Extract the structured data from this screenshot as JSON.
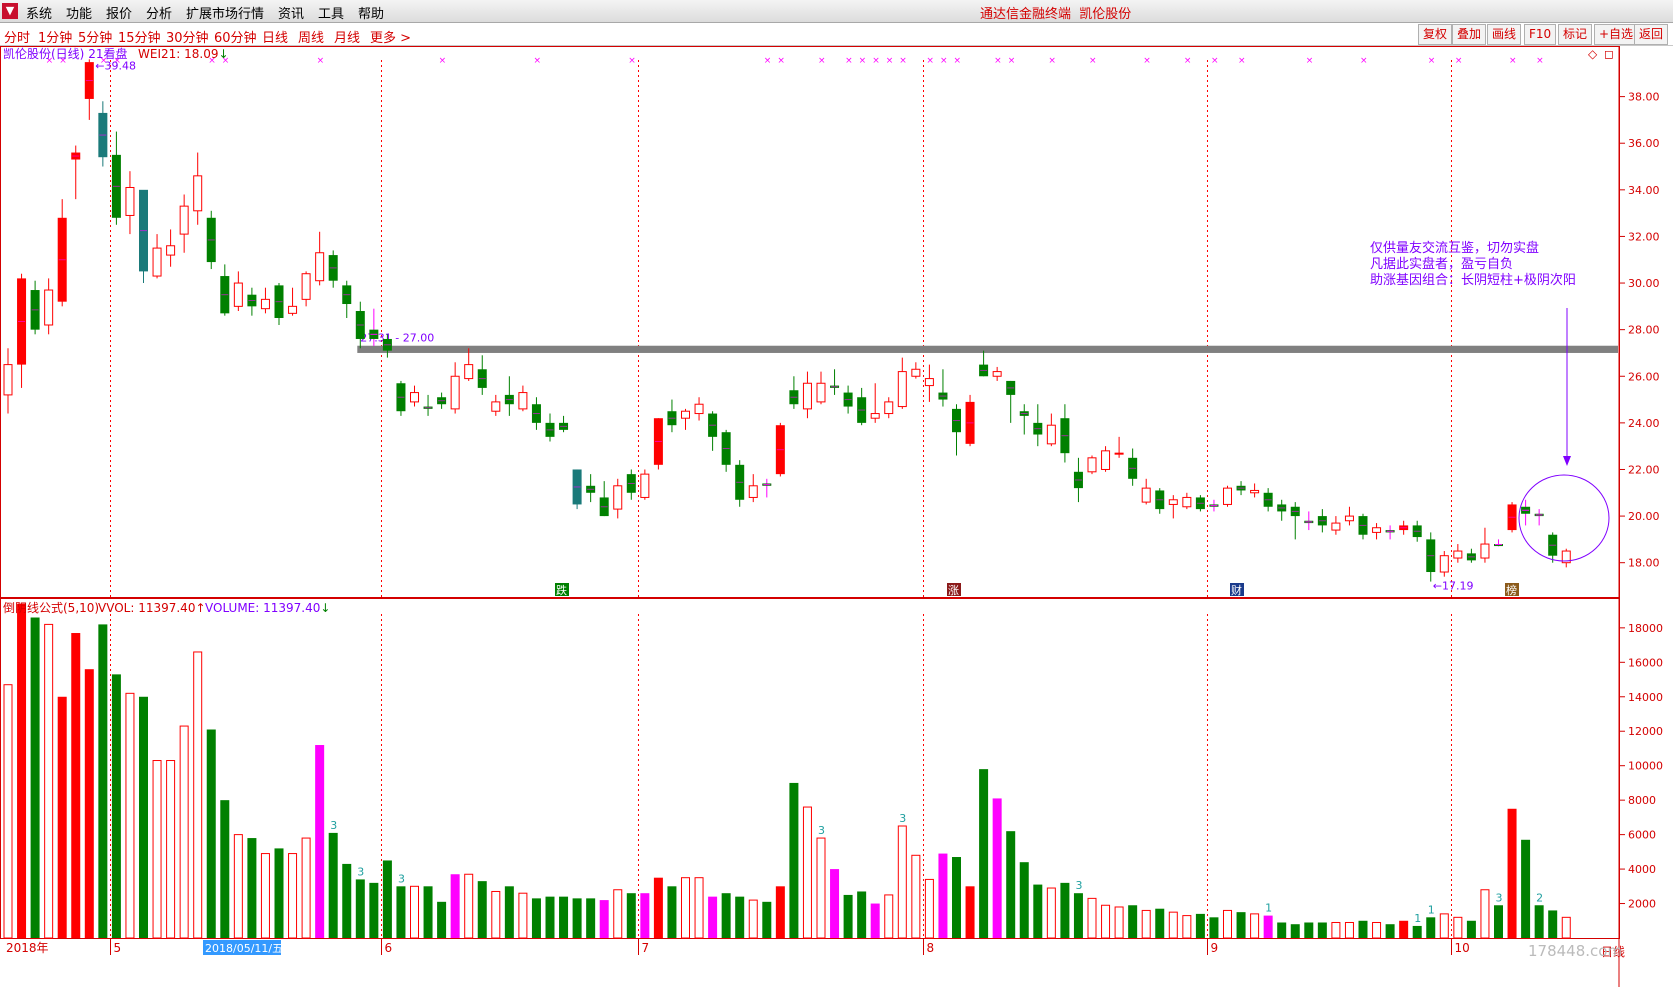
{
  "menu": {
    "items": [
      "系统",
      "功能",
      "报价",
      "分析",
      "扩展市场行情",
      "资讯",
      "工具",
      "帮助"
    ],
    "title": "通达信金融终端",
    "stock": "凯伦股份"
  },
  "periods": {
    "items": [
      "分时",
      "1分钟",
      "5分钟",
      "15分钟",
      "30分钟",
      "60分钟",
      "日线",
      "周线",
      "月线",
      "更多 >"
    ],
    "active": "日线"
  },
  "toolbar": [
    "复权",
    "叠加",
    "画线",
    "F10",
    "标记",
    "+自选",
    "返回"
  ],
  "price_panel": {
    "title_main": "凯伦股份(日线)",
    "title_extra": "21看盘",
    "indicator": "WEI21: 18.09",
    "indicator_arrow": "↓",
    "high_label": "39.48",
    "low_label": "17.19",
    "hline_label": "27.31 - 27.00",
    "y_ticks": [
      "38.00",
      "36.00",
      "34.00",
      "32.00",
      "30.00",
      "28.00",
      "26.00",
      "24.00",
      "22.00",
      "20.00",
      "18.00"
    ],
    "annotation": [
      "仅供量友交流互鉴，切勿实盘",
      "凡据此实盘者，盈亏自负",
      "助涨基因组合：长阴短柱+极阴次阳"
    ],
    "markers": [
      "跌",
      "涨",
      "财",
      "榜"
    ],
    "corner_mark": "◇"
  },
  "volume_panel": {
    "title_formula": "倒阴线公式(5,10)",
    "vvol_label": "VVOL: 11397.40",
    "vvol_arrow": "↑",
    "volume_label": "VOLUME: 11397.40",
    "volume_arrow": "↓",
    "y_ticks": [
      "18000",
      "16000",
      "14000",
      "12000",
      "10000",
      "8000",
      "6000",
      "4000",
      "2000"
    ],
    "counts": [
      "3",
      "3",
      "3",
      "3",
      "3",
      "3",
      "1",
      "1",
      "1",
      "3",
      "2"
    ]
  },
  "date_axis": {
    "year": "2018年",
    "months": [
      "5",
      "6",
      "7",
      "8",
      "9",
      "10"
    ],
    "selected_date": "2018/05/11/五",
    "right_label": "日线",
    "watermark": "178448.com"
  },
  "colors": {
    "up": "#ff0000",
    "down": "#008000",
    "teal": "#1a7a7a",
    "magenta": "#ff00ff",
    "purple": "#8000ff",
    "hline": "#808080",
    "grid_v": "#ff0000",
    "label_red": "#d40000"
  },
  "chart_data": {
    "type": "candlestick",
    "price_range": [
      17,
      40
    ],
    "volume_range": [
      0,
      19500
    ],
    "candles": [
      [
        25.2,
        26.5,
        27.2,
        24.4,
        "h",
        14700
      ],
      [
        26.5,
        30.2,
        30.4,
        25.5,
        "f",
        19400
      ],
      [
        29.7,
        28.0,
        30.1,
        27.8,
        "d",
        18600
      ],
      [
        28.2,
        29.7,
        30.2,
        27.8,
        "h",
        18200
      ],
      [
        29.2,
        32.8,
        33.6,
        29.0,
        "f",
        14000
      ],
      [
        35.3,
        35.6,
        35.9,
        33.6,
        "f",
        17700
      ],
      [
        37.9,
        39.48,
        39.6,
        37.0,
        "f",
        15600
      ],
      [
        37.3,
        35.4,
        37.8,
        35.0,
        "t",
        18200
      ],
      [
        35.5,
        32.8,
        36.5,
        32.5,
        "d",
        15300
      ],
      [
        32.9,
        34.1,
        34.8,
        32.1,
        "h",
        14200
      ],
      [
        34.0,
        30.5,
        33.8,
        30.0,
        "t",
        14000
      ],
      [
        30.3,
        31.5,
        32.1,
        30.2,
        "h",
        10300
      ],
      [
        31.2,
        31.6,
        32.3,
        30.7,
        "h",
        10300
      ],
      [
        32.1,
        33.3,
        33.8,
        31.3,
        "h",
        12300
      ],
      [
        33.1,
        34.6,
        35.6,
        32.5,
        "h",
        16600
      ],
      [
        32.8,
        30.9,
        33.1,
        30.6,
        "d",
        12100
      ],
      [
        30.3,
        28.7,
        30.8,
        28.6,
        "d",
        8000
      ],
      [
        29.0,
        30.0,
        30.5,
        28.8,
        "h",
        6000
      ],
      [
        29.5,
        29.0,
        29.8,
        28.6,
        "d",
        5800
      ],
      [
        28.9,
        29.3,
        29.8,
        28.7,
        "h",
        4900
      ],
      [
        29.9,
        28.5,
        30.0,
        28.2,
        "d",
        5200
      ],
      [
        28.7,
        29.0,
        29.8,
        28.6,
        "h",
        4900
      ],
      [
        29.3,
        30.4,
        30.5,
        29.0,
        "h",
        5800
      ],
      [
        30.1,
        31.3,
        32.2,
        29.9,
        "h",
        11200
      ],
      [
        31.2,
        30.1,
        31.4,
        29.8,
        "d",
        6100
      ],
      [
        29.9,
        29.1,
        30.1,
        28.5,
        "d",
        4300
      ],
      [
        28.8,
        27.6,
        29.2,
        27.2,
        "d",
        3400
      ],
      [
        27.6,
        28.0,
        28.9,
        27.3,
        "m",
        3200
      ],
      [
        27.6,
        27.1,
        27.8,
        26.8,
        "d",
        4500
      ],
      [
        25.7,
        24.5,
        25.8,
        24.3,
        "d",
        3000
      ],
      [
        24.9,
        25.3,
        25.6,
        24.7,
        "h",
        3000
      ],
      [
        24.7,
        24.6,
        25.2,
        24.3,
        "d",
        3000
      ],
      [
        25.1,
        24.8,
        25.3,
        24.6,
        "d",
        2100
      ],
      [
        24.6,
        26.0,
        26.6,
        24.4,
        "h",
        3700
      ],
      [
        25.9,
        26.5,
        27.2,
        25.8,
        "h",
        3700
      ],
      [
        26.3,
        25.5,
        26.9,
        25.2,
        "d",
        3300
      ],
      [
        24.9,
        24.5,
        25.2,
        24.3,
        "h",
        2700
      ],
      [
        25.2,
        24.8,
        26.0,
        24.3,
        "d",
        3000
      ],
      [
        24.6,
        25.3,
        25.6,
        24.5,
        "h",
        2600
      ],
      [
        24.8,
        24.0,
        25.1,
        23.7,
        "d",
        2300
      ],
      [
        24.0,
        23.4,
        24.4,
        23.2,
        "d",
        2400
      ],
      [
        24.0,
        23.7,
        24.3,
        23.6,
        "d",
        2400
      ],
      [
        22.0,
        20.5,
        22.0,
        20.3,
        "t",
        2300
      ],
      [
        21.3,
        21.0,
        21.8,
        20.6,
        "d",
        2300
      ],
      [
        20.8,
        20.0,
        21.5,
        20.0,
        "d",
        2200
      ],
      [
        20.3,
        21.3,
        21.6,
        19.9,
        "h",
        2800
      ],
      [
        21.8,
        21.0,
        22.0,
        20.7,
        "d",
        2600
      ],
      [
        20.8,
        21.8,
        22.0,
        20.7,
        "h",
        2600
      ],
      [
        22.2,
        24.2,
        24.2,
        22.0,
        "f",
        3500
      ],
      [
        24.5,
        23.9,
        25.0,
        23.6,
        "d",
        3000
      ],
      [
        24.2,
        24.5,
        24.6,
        23.7,
        "h",
        3500
      ],
      [
        24.8,
        24.4,
        25.1,
        24.1,
        "h",
        3500
      ],
      [
        24.4,
        23.4,
        24.5,
        22.8,
        "d",
        2400
      ],
      [
        23.6,
        22.2,
        23.7,
        21.9,
        "d",
        2600
      ],
      [
        22.2,
        20.7,
        22.4,
        20.4,
        "d",
        2400
      ],
      [
        20.8,
        21.3,
        21.8,
        20.6,
        "h",
        2200
      ],
      [
        21.4,
        21.3,
        21.6,
        20.8,
        "m",
        2100
      ],
      [
        21.8,
        23.9,
        24.0,
        21.7,
        "f",
        3000
      ],
      [
        25.4,
        24.8,
        26.0,
        24.6,
        "d",
        9000
      ],
      [
        24.6,
        25.7,
        26.2,
        24.2,
        "h",
        7600
      ],
      [
        24.9,
        25.7,
        26.2,
        24.8,
        "h",
        5800
      ],
      [
        25.6,
        25.5,
        26.3,
        25.2,
        "d",
        4000
      ],
      [
        25.3,
        24.7,
        25.6,
        24.4,
        "d",
        2500
      ],
      [
        25.1,
        24.0,
        25.5,
        23.9,
        "d",
        2700
      ],
      [
        24.2,
        24.4,
        25.7,
        24.0,
        "h",
        2000
      ],
      [
        24.4,
        24.9,
        25.1,
        24.2,
        "h",
        2500
      ],
      [
        24.7,
        26.2,
        26.8,
        24.6,
        "h",
        6500
      ],
      [
        26.0,
        26.3,
        26.6,
        25.9,
        "h",
        4800
      ],
      [
        25.9,
        25.6,
        26.5,
        24.9,
        "h",
        3400
      ],
      [
        25.3,
        25.0,
        26.3,
        24.7,
        "d",
        4900
      ],
      [
        24.6,
        23.6,
        24.8,
        22.6,
        "d",
        4700
      ],
      [
        23.1,
        24.9,
        25.2,
        23.0,
        "f",
        3000
      ],
      [
        26.0,
        26.5,
        27.1,
        26.0,
        "d",
        9800
      ],
      [
        26.2,
        26.0,
        26.4,
        25.8,
        "h",
        8100
      ],
      [
        25.8,
        25.2,
        25.8,
        24.0,
        "d",
        6200
      ],
      [
        24.5,
        24.3,
        24.8,
        23.5,
        "d",
        4400
      ],
      [
        24.0,
        23.5,
        24.8,
        23.0,
        "d",
        3100
      ],
      [
        23.1,
        23.9,
        24.4,
        23.0,
        "h",
        2900
      ],
      [
        24.2,
        22.7,
        24.8,
        22.3,
        "d",
        3200
      ],
      [
        21.9,
        21.2,
        22.5,
        20.6,
        "d",
        2600
      ],
      [
        21.9,
        22.5,
        22.6,
        21.8,
        "h",
        2300
      ],
      [
        22.0,
        22.8,
        23.0,
        21.9,
        "h",
        1900
      ],
      [
        22.7,
        22.7,
        23.4,
        22.5,
        "h",
        1800
      ],
      [
        22.5,
        21.6,
        22.9,
        21.3,
        "d",
        1900
      ],
      [
        21.2,
        20.6,
        21.6,
        20.5,
        "h",
        1600
      ],
      [
        21.1,
        20.3,
        21.2,
        20.1,
        "d",
        1700
      ],
      [
        20.5,
        20.7,
        20.9,
        19.9,
        "h",
        1500
      ],
      [
        20.4,
        20.8,
        21.0,
        20.3,
        "h",
        1300
      ],
      [
        20.8,
        20.3,
        20.9,
        20.2,
        "d",
        1400
      ],
      [
        20.4,
        20.5,
        20.7,
        20.2,
        "m",
        1200
      ],
      [
        20.5,
        21.2,
        21.3,
        20.4,
        "h",
        1600
      ],
      [
        21.3,
        21.1,
        21.5,
        20.9,
        "d",
        1500
      ],
      [
        21.0,
        21.1,
        21.4,
        20.8,
        "h",
        1400
      ],
      [
        21.0,
        20.4,
        21.2,
        20.2,
        "d",
        1300
      ],
      [
        20.5,
        20.2,
        20.7,
        19.8,
        "d",
        900
      ],
      [
        20.4,
        20.0,
        20.6,
        19.0,
        "d",
        800
      ],
      [
        19.8,
        19.7,
        20.2,
        19.4,
        "m",
        900
      ],
      [
        20.0,
        19.6,
        20.3,
        19.3,
        "d",
        900
      ],
      [
        19.4,
        19.7,
        20.0,
        19.2,
        "h",
        900
      ],
      [
        19.8,
        20.0,
        20.4,
        19.6,
        "h",
        900
      ],
      [
        20.0,
        19.2,
        20.1,
        19.0,
        "d",
        1000
      ],
      [
        19.5,
        19.3,
        19.7,
        19.0,
        "h",
        900
      ],
      [
        19.3,
        19.4,
        19.6,
        19.0,
        "m",
        800
      ],
      [
        19.6,
        19.4,
        19.8,
        19.2,
        "f",
        1000
      ],
      [
        19.6,
        19.1,
        19.8,
        18.9,
        "d",
        700
      ],
      [
        19.0,
        17.6,
        19.3,
        17.19,
        "d",
        1200
      ],
      [
        17.6,
        18.3,
        18.5,
        17.4,
        "h",
        1400
      ],
      [
        18.2,
        18.5,
        18.8,
        18.0,
        "h",
        1200
      ],
      [
        18.4,
        18.1,
        18.6,
        18.0,
        "d",
        1000
      ],
      [
        18.2,
        18.8,
        19.5,
        18.0,
        "h",
        2800
      ],
      [
        18.8,
        18.8,
        19.0,
        18.7,
        "m",
        1900
      ],
      [
        19.4,
        20.5,
        20.6,
        19.3,
        "f",
        7500
      ],
      [
        20.4,
        20.1,
        20.7,
        19.6,
        "m",
        5700
      ],
      [
        20.0,
        20.1,
        20.3,
        19.6,
        "m",
        1900
      ],
      [
        19.2,
        18.3,
        19.3,
        18.0,
        "d",
        1600
      ],
      [
        18.0,
        18.5,
        18.6,
        17.8,
        "h",
        1200
      ]
    ],
    "vol_special": {
      "23": "m",
      "33": "m",
      "44": "m",
      "47": "m",
      "52": "m",
      "61": "m",
      "64": "m",
      "69": "m",
      "73": "m",
      "93": "m"
    },
    "count_marks": [
      [
        24,
        "3"
      ],
      [
        26,
        "3"
      ],
      [
        29,
        "3"
      ],
      [
        60,
        "3"
      ],
      [
        66,
        "3"
      ],
      [
        79,
        "3"
      ],
      [
        93,
        "1"
      ],
      [
        104,
        "1"
      ],
      [
        105,
        "1"
      ],
      [
        110,
        "3"
      ],
      [
        113,
        "2"
      ]
    ],
    "top_x_marks": [
      3,
      4,
      7,
      8,
      15,
      16,
      23,
      32,
      39,
      46,
      56,
      57,
      60,
      62,
      63,
      64,
      65,
      66,
      68,
      69,
      70,
      73,
      74,
      77,
      80,
      84,
      87,
      89,
      91,
      96,
      100,
      105,
      107,
      111,
      113
    ]
  }
}
